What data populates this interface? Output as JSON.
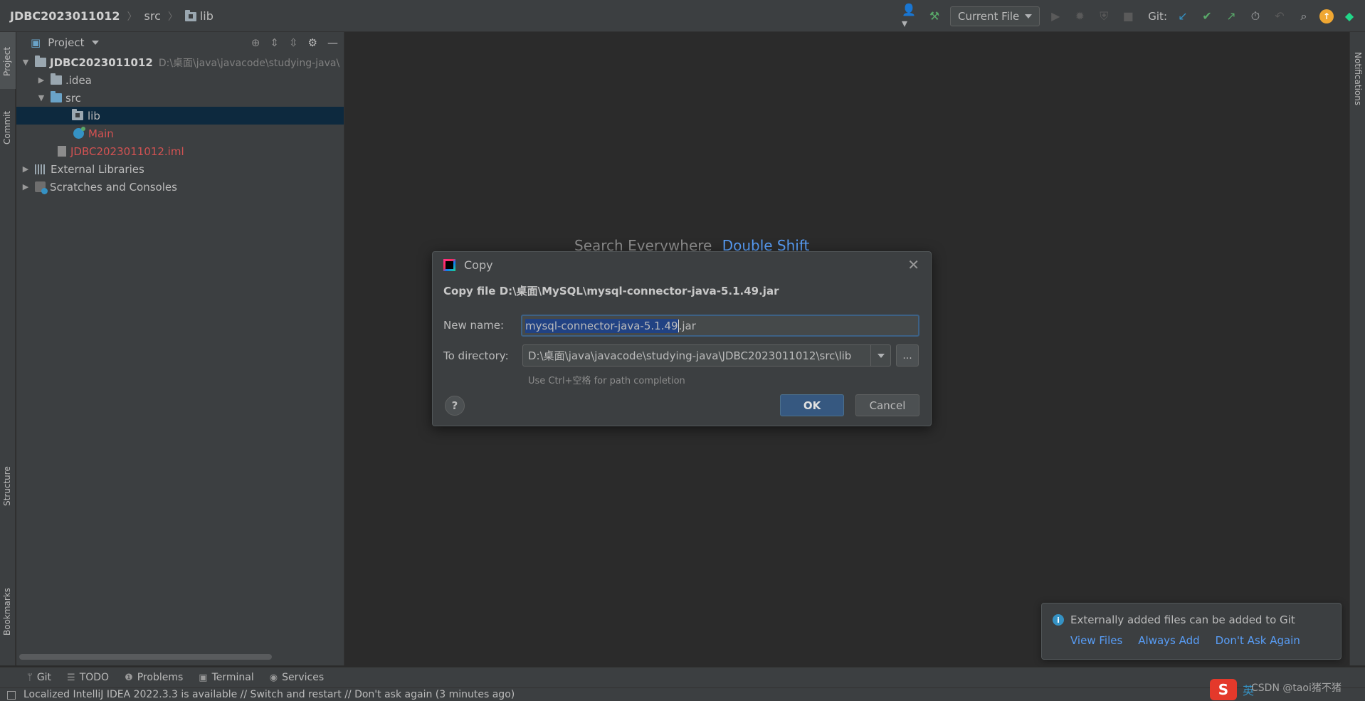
{
  "breadcrumb": {
    "project": "JDBC2023011012",
    "folder1": "src",
    "folder2": "lib"
  },
  "toolbar": {
    "run_config": "Current File",
    "git_label": "Git:"
  },
  "left_strip": {
    "project": "Project",
    "commit": "Commit",
    "structure": "Structure",
    "bookmarks": "Bookmarks"
  },
  "right_strip": {
    "notifications": "Notifications"
  },
  "project_panel": {
    "title": "Project",
    "tree": [
      {
        "label": "JDBC2023011012",
        "path": "D:\\桌面\\java\\javacode\\studying-java\\"
      },
      {
        "label": ".idea"
      },
      {
        "label": "src"
      },
      {
        "label": "lib"
      },
      {
        "label": "Main"
      },
      {
        "label": "JDBC2023011012.iml"
      },
      {
        "label": "External Libraries"
      },
      {
        "label": "Scratches and Consoles"
      }
    ]
  },
  "editor": {
    "hint_text": "Search Everywhere",
    "hint_shortcut": "Double Shift"
  },
  "dialog": {
    "title": "Copy",
    "heading": "Copy file D:\\桌面\\MySQL\\mysql-connector-java-5.1.49.jar",
    "new_name_label": "New name:",
    "new_name_selected": "mysql-connector-java-5.1.49",
    "new_name_rest": ".jar",
    "to_dir_label": "To directory:",
    "to_dir_value": "D:\\桌面\\java\\javacode\\studying-java\\JDBC2023011012\\src\\lib",
    "browse": "...",
    "hint": "Use Ctrl+空格 for path completion",
    "help": "?",
    "ok": "OK",
    "cancel": "Cancel"
  },
  "notification": {
    "text": "Externally added files can be added to Git",
    "actions": [
      "View Files",
      "Always Add",
      "Don't Ask Again"
    ]
  },
  "bottom_tabs": [
    "Git",
    "TODO",
    "Problems",
    "Terminal",
    "Services"
  ],
  "status": {
    "message": "Localized IntelliJ IDEA 2022.3.3 is available // Switch and restart // Don't ask again (3 minutes ago)"
  },
  "ime": {
    "logo": "S",
    "lang": "英"
  },
  "watermark": "CSDN @taoi猪不猪",
  "colors": {
    "accent": "#589df6",
    "selection": "#0d293e",
    "red_file": "#d25252",
    "ok_button": "#365880"
  }
}
